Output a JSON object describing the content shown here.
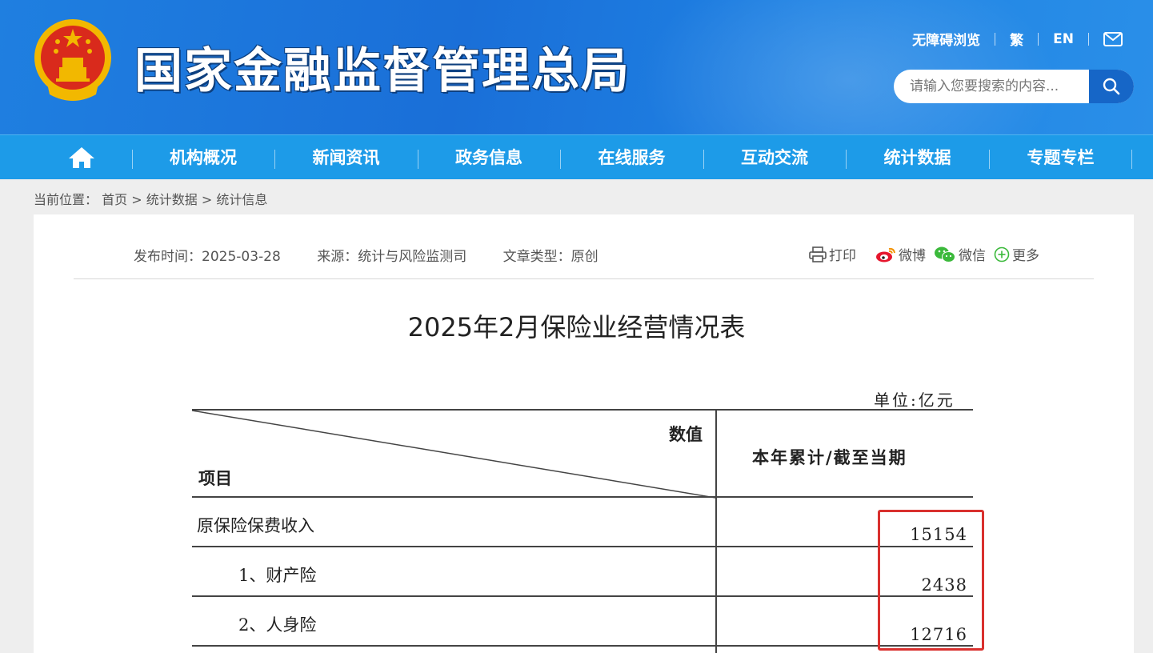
{
  "header": {
    "site_title": "国家金融监督管理总局",
    "links": [
      "无障碍浏览",
      "繁",
      "EN"
    ],
    "search_placeholder": "请输入您要搜索的内容..."
  },
  "nav": {
    "items": [
      "机构概况",
      "新闻资讯",
      "政务信息",
      "在线服务",
      "互动交流",
      "统计数据",
      "专题专栏"
    ]
  },
  "breadcrumb": {
    "label": "当前位置：",
    "items": [
      "首页",
      "统计数据",
      "统计信息"
    ],
    "separator": ">"
  },
  "article": {
    "publish_time": "发布时间：2025-03-28",
    "source": "来源：统计与风险监测司",
    "type": "文章类型：原创",
    "share": {
      "print": "打印",
      "weibo": "微博",
      "wechat": "微信",
      "more": "更多"
    },
    "title": "2025年2月保险业经营情况表"
  },
  "table": {
    "unit": "单位:亿元",
    "header_value": "数值",
    "header_item": "项目",
    "header_column": "本年累计/截至当期",
    "rows": [
      {
        "label": "原保险保费收入",
        "value": "15154"
      },
      {
        "label": "1、财产险",
        "value": "2438"
      },
      {
        "label": "2、人身险",
        "value": "12716"
      }
    ]
  },
  "colors": {
    "header_blue": "#1f7fe0",
    "nav_blue": "#1d9be8",
    "search_button": "#1666c7",
    "highlight_red": "#d9302e"
  }
}
